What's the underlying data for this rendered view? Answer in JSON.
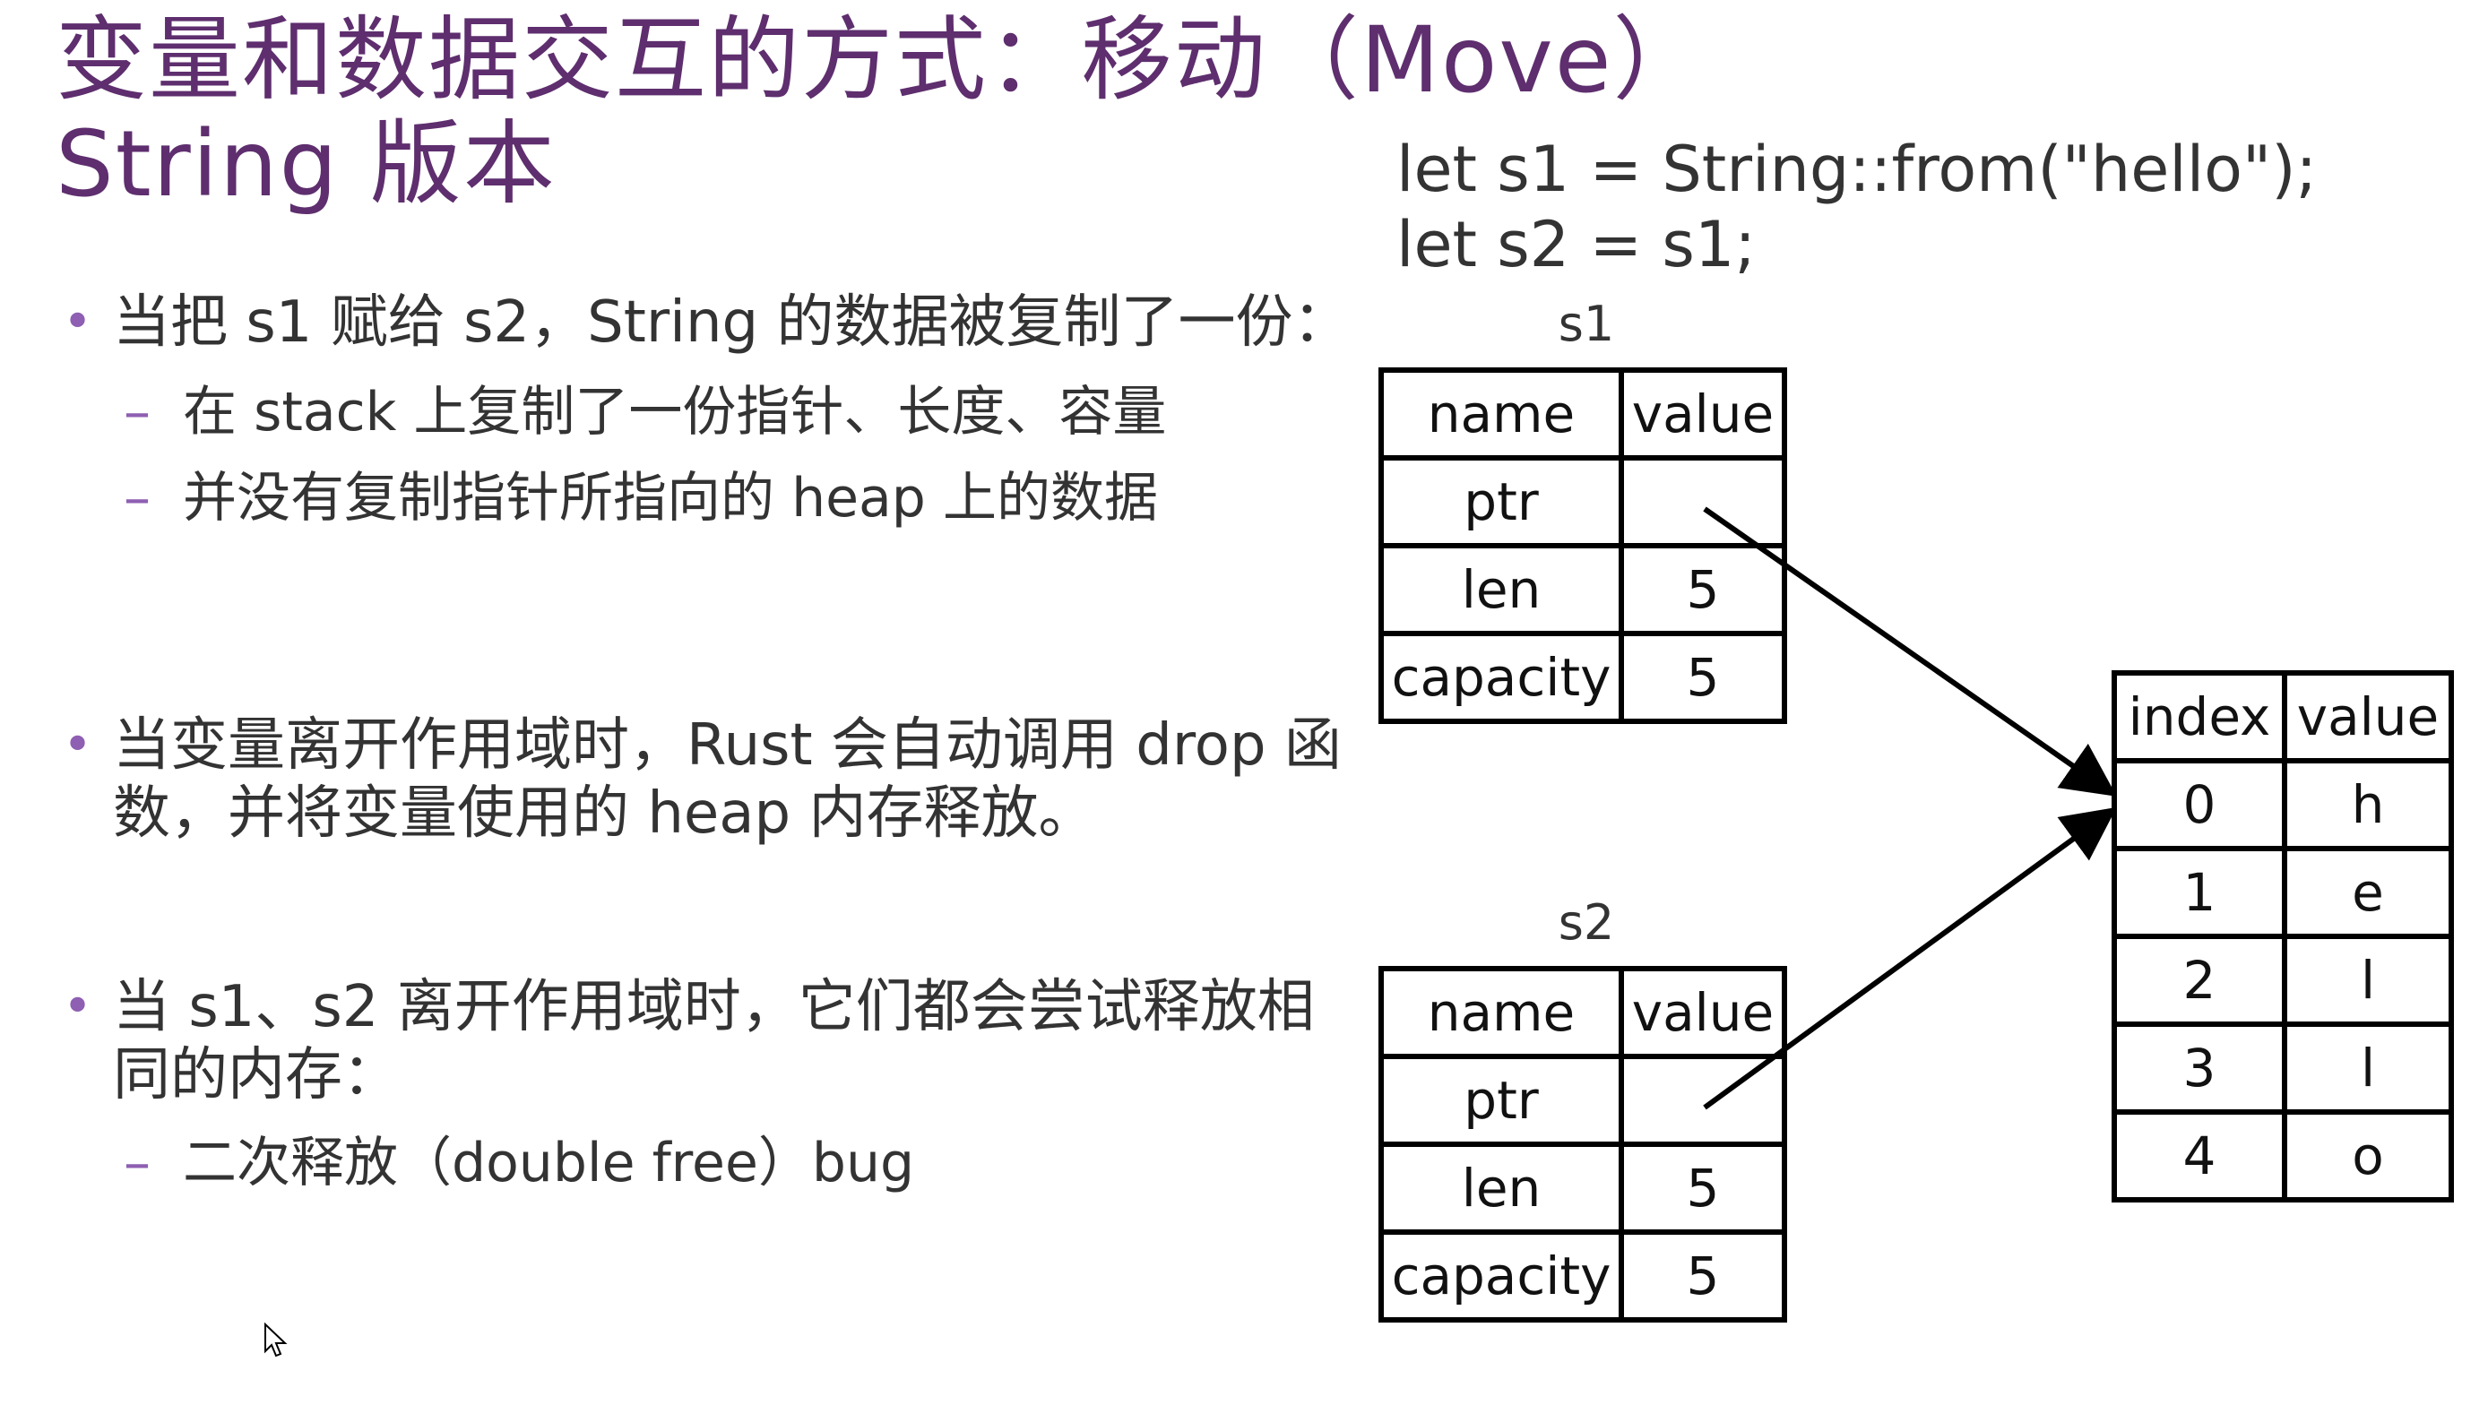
{
  "title": {
    "line1": "变量和数据交互的方式：移动（Move）",
    "line2": "String 版本"
  },
  "code": {
    "line1": "let s1 = String::from(\"hello\");",
    "line2": "let s2 = s1;"
  },
  "bullets": [
    {
      "text": "当把 s1 赋给 s2，String 的数据被复制了一份：",
      "subs": [
        "在 stack 上复制了一份指针、长度、容量",
        "并没有复制指针所指向的 heap 上的数据"
      ]
    },
    {
      "text": "当变量离开作用域时，Rust 会自动调用 drop 函数，并将变量使用的 heap 内存释放。",
      "subs": []
    },
    {
      "text": "当 s1、s2 离开作用域时，它们都会尝试释放相同的内存：",
      "subs": [
        "二次释放（double free）bug"
      ]
    }
  ],
  "s1": {
    "label": "s1",
    "headers": [
      "name",
      "value"
    ],
    "rows": [
      [
        "ptr",
        ""
      ],
      [
        "len",
        "5"
      ],
      [
        "capacity",
        "5"
      ]
    ]
  },
  "s2": {
    "label": "s2",
    "headers": [
      "name",
      "value"
    ],
    "rows": [
      [
        "ptr",
        ""
      ],
      [
        "len",
        "5"
      ],
      [
        "capacity",
        "5"
      ]
    ]
  },
  "heap": {
    "headers": [
      "index",
      "value"
    ],
    "rows": [
      [
        "0",
        "h"
      ],
      [
        "1",
        "e"
      ],
      [
        "2",
        "l"
      ],
      [
        "3",
        "l"
      ],
      [
        "4",
        "o"
      ]
    ]
  },
  "colors": {
    "title": "#5e2e6e",
    "bullet_marker": "#8e5fb2",
    "text": "#333333"
  },
  "icons": {
    "cursor": "mouse-pointer-icon"
  }
}
